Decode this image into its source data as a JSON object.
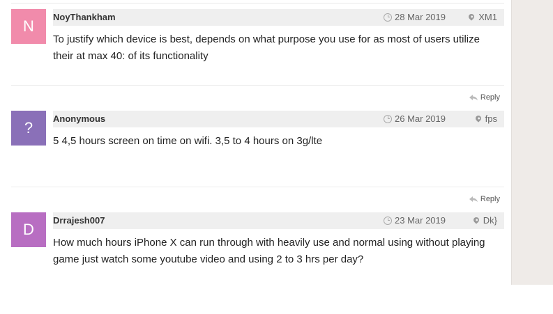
{
  "comments": [
    {
      "avatar_letter": "N",
      "avatar_color": "#f18bab",
      "author": "NoyThankham",
      "date": "28 Mar 2019",
      "location": "XM1",
      "text": "To justify which device is best, depends on what purpose you use for as most of users utilize their at max 40: of its functionality",
      "reply_label": "Reply"
    },
    {
      "avatar_letter": "?",
      "avatar_color": "#8a70b8",
      "author": "Anonymous",
      "date": "26 Mar 2019",
      "location": "fps",
      "text": "5 4,5 hours screen on time on wifi. 3,5 to 4 hours on 3g/lte",
      "reply_label": "Reply"
    },
    {
      "avatar_letter": "D",
      "avatar_color": "#b86ec2",
      "author": "Drrajesh007",
      "date": "23 Mar 2019",
      "location": "Dk}",
      "text": "How much hours iPhone X can run through with heavily use and normal using without playing game just watch some youtube video and using 2 to 3 hrs per day?",
      "reply_label": "Reply"
    }
  ],
  "icons": {
    "date": "clock-icon",
    "location": "map-pin-icon",
    "reply": "reply-arrow-icon"
  }
}
